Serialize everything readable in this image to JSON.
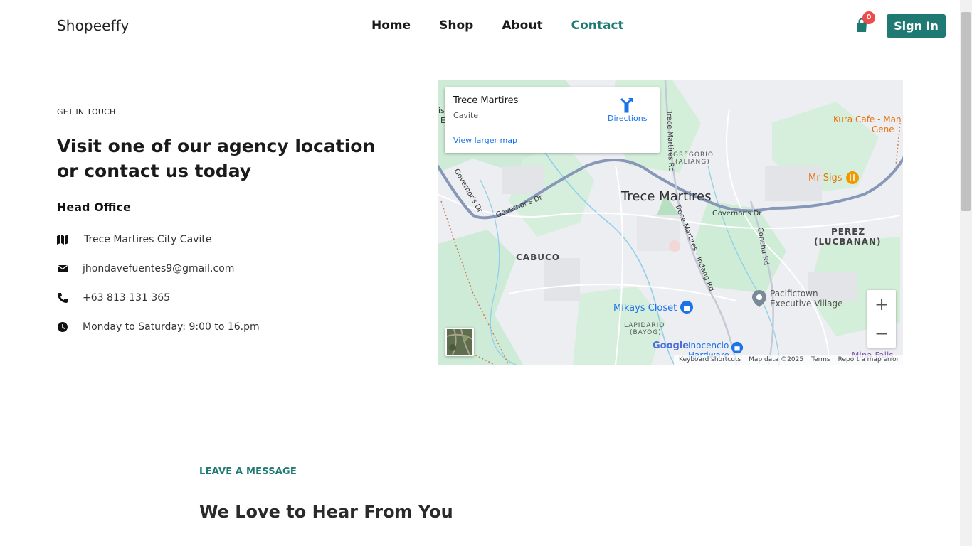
{
  "header": {
    "brand": "Shopeeffy",
    "nav": [
      {
        "label": "Home"
      },
      {
        "label": "Shop"
      },
      {
        "label": "About"
      },
      {
        "label": "Contact",
        "active": true
      }
    ],
    "cart_count": "0",
    "signin_label": "Sign In",
    "accent_color": "#1e7a72",
    "badge_color": "#f04b4b"
  },
  "contact": {
    "eyebrow": "GET IN TOUCH",
    "headline": "Visit one of our agency location or contact us today",
    "office_title": "Head Office",
    "address": {
      "icon": "map-icon",
      "text": "Trece Martires City Cavite"
    },
    "email": {
      "icon": "envelope-icon",
      "text": "jhondavefuentes9@gmail.com"
    },
    "phone": {
      "icon": "phone-icon",
      "text": "+63 813 131 365"
    },
    "hours": {
      "icon": "clock-icon",
      "text": "Monday to Saturday: 9:00 to 16.pm"
    }
  },
  "map": {
    "card": {
      "place": "Trece Martires",
      "region": "Cavite",
      "directions": "Directions",
      "larger_map": "View larger map"
    },
    "labels": {
      "city": "Trece Martires",
      "cabuco": "CABUCO",
      "perez": "PEREZ",
      "perez_sub": "(LUCBANAN)",
      "gregorio": "GREGORIO",
      "gregorio_sub": "(ALIANG)",
      "lapidario": "LAPIDARIO",
      "lapidario_sub": "(BAYOG)",
      "governors_dr": "Governor's Dr",
      "governors_dr_right": "Governor's Dr",
      "governors_dr_left": "Governor's Dr",
      "trece_indang": "Trece Martires - Indang Rd",
      "trece_rd": "Trece Martires Rd",
      "conchu": "Conchu Rd",
      "mikays": "Mikays Closet",
      "mr_sigs": "Mr Sigs",
      "kura": "Kura Cafe - Man",
      "kura_sub": "Gene",
      "pacifictown": "Pacifictown",
      "pacifictown_sub": "Executive Village",
      "inocencio": "Inocencio",
      "hardware": "Hardware",
      "mina": "Mina Falls",
      "stub_left": "is",
      "stub_left2": "E",
      "za": "nza"
    },
    "google": "Google",
    "footer": {
      "shortcuts": "Keyboard shortcuts",
      "data": "Map data ©2025",
      "terms": "Terms",
      "report": "Report a map error"
    },
    "zoom_in": "+",
    "zoom_out": "−"
  },
  "message": {
    "eyebrow": "LEAVE A MESSAGE",
    "title": "We Love to Hear From You"
  }
}
